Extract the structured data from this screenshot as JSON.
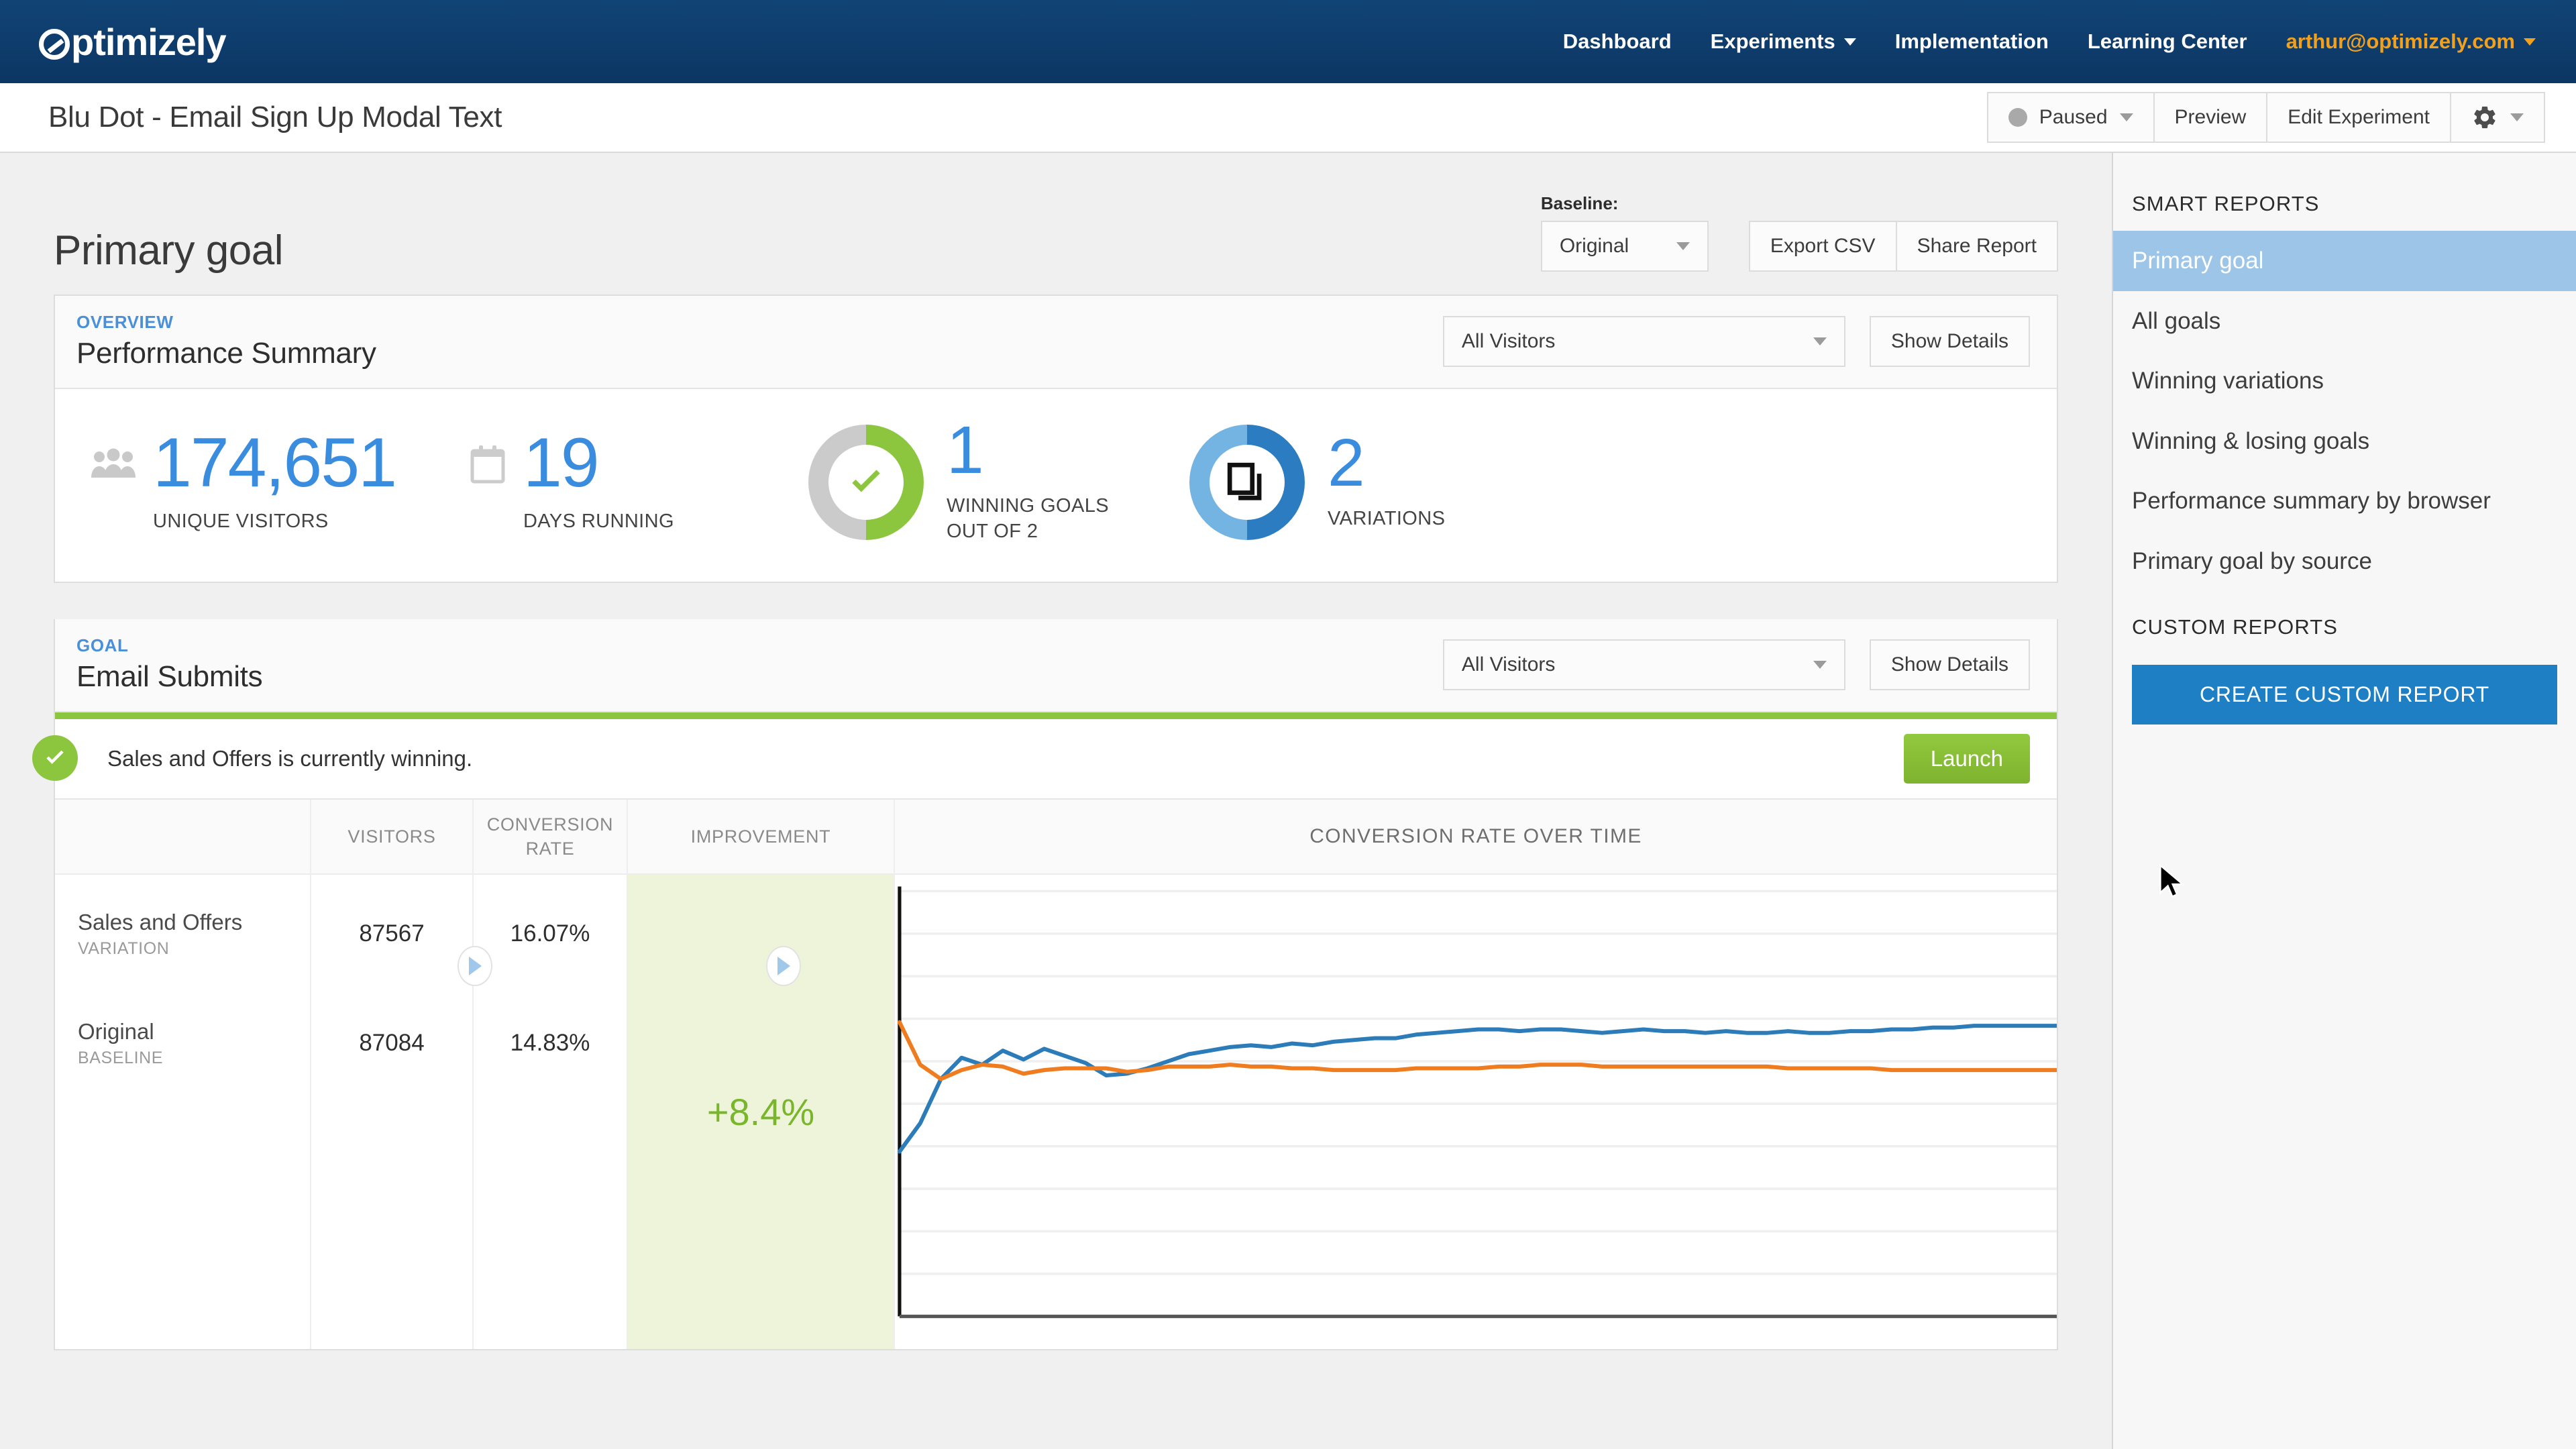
{
  "topnav": {
    "logo_text": "ptimizely",
    "items": [
      {
        "label": "Dashboard",
        "has_caret": false
      },
      {
        "label": "Experiments",
        "has_caret": true
      },
      {
        "label": "Implementation",
        "has_caret": false
      },
      {
        "label": "Learning Center",
        "has_caret": false
      }
    ],
    "user": "arthur@optimizely.com",
    "brand_color": "#0d3c6e",
    "user_color": "#f2a11e"
  },
  "subheader": {
    "experiment_title": "Blu Dot - Email Sign Up Modal Text",
    "status_label": "Paused",
    "preview_label": "Preview",
    "edit_label": "Edit Experiment"
  },
  "main": {
    "page_title": "Primary goal",
    "baseline_label": "Baseline:",
    "baseline_value": "Original",
    "export_csv_label": "Export CSV",
    "share_report_label": "Share Report"
  },
  "summary": {
    "kicker": "OVERVIEW",
    "title": "Performance Summary",
    "audience_value": "All Visitors",
    "show_details_label": "Show Details",
    "unique_visitors": "174,651",
    "unique_visitors_label": "UNIQUE VISITORS",
    "days_running": "19",
    "days_running_label": "DAYS RUNNING",
    "winning_goals": "1",
    "winning_goals_label_1": "WINNING GOALS",
    "winning_goals_label_2": "OUT OF 2",
    "variations": "2",
    "variations_label": "VARIATIONS"
  },
  "goal": {
    "kicker": "GOAL",
    "title": "Email Submits",
    "audience_value": "All Visitors",
    "show_details_label": "Show Details",
    "winning_message": "Sales and Offers is currently winning.",
    "launch_label": "Launch",
    "accent_color": "#8cc63e",
    "columns": {
      "name": "",
      "visitors": "VISITORS",
      "conversion_rate_line1": "CONVERSION",
      "conversion_rate_line2": "RATE",
      "improvement": "IMPROVEMENT",
      "chart": "CONVERSION RATE OVER TIME"
    },
    "rows": [
      {
        "name": "Sales and Offers",
        "type": "VARIATION",
        "visitors": "87567",
        "conversion_rate": "16.07%"
      },
      {
        "name": "Original",
        "type": "BASELINE",
        "visitors": "87084",
        "conversion_rate": "14.83%"
      }
    ],
    "improvement": "+8.4%"
  },
  "chart_data": {
    "type": "line",
    "title": "CONVERSION RATE OVER TIME",
    "xlabel": "",
    "ylabel": "",
    "grid": true,
    "legend": "none",
    "ylim": [
      0,
      24
    ],
    "series": [
      {
        "name": "Sales and Offers",
        "color": "#2b7cb8",
        "values": [
          9.3,
          10.9,
          13.4,
          14.6,
          14.2,
          15.0,
          14.5,
          15.1,
          14.7,
          14.3,
          13.6,
          13.7,
          14.0,
          14.4,
          14.8,
          15.0,
          15.2,
          15.3,
          15.2,
          15.4,
          15.3,
          15.5,
          15.6,
          15.7,
          15.7,
          15.9,
          16.0,
          16.1,
          16.2,
          16.2,
          16.1,
          16.2,
          16.2,
          16.1,
          16.0,
          16.1,
          16.2,
          16.1,
          16.1,
          16.0,
          16.1,
          16.0,
          16.0,
          16.1,
          16.0,
          16.0,
          16.1,
          16.1,
          16.2,
          16.2,
          16.3,
          16.3,
          16.4,
          16.4,
          16.4,
          16.4,
          16.4
        ]
      },
      {
        "name": "Original",
        "color": "#f07c20",
        "values": [
          16.6,
          14.2,
          13.4,
          13.9,
          14.2,
          14.1,
          13.7,
          13.9,
          14.0,
          14.0,
          14.0,
          13.8,
          13.9,
          14.1,
          14.1,
          14.1,
          14.2,
          14.1,
          14.1,
          14.0,
          14.0,
          13.9,
          13.9,
          13.9,
          13.9,
          14.0,
          14.0,
          14.0,
          14.0,
          14.1,
          14.1,
          14.2,
          14.2,
          14.2,
          14.1,
          14.1,
          14.1,
          14.1,
          14.1,
          14.1,
          14.1,
          14.1,
          14.1,
          14.0,
          14.0,
          14.0,
          14.0,
          14.0,
          13.9,
          13.9,
          13.9,
          13.9,
          13.9,
          13.9,
          13.9,
          13.9,
          13.9
        ]
      }
    ]
  },
  "sidebar": {
    "smart_reports_title": "SMART REPORTS",
    "items": [
      {
        "label": "Primary goal",
        "active": true
      },
      {
        "label": "All goals",
        "active": false
      },
      {
        "label": "Winning variations",
        "active": false
      },
      {
        "label": "Winning & losing goals",
        "active": false
      },
      {
        "label": "Performance summary by browser",
        "active": false
      },
      {
        "label": "Primary goal by source",
        "active": false
      }
    ],
    "custom_reports_title": "CUSTOM REPORTS",
    "create_button_label": "CREATE CUSTOM REPORT",
    "create_button_color": "#1f7fc4",
    "active_color": "#9cc5e8"
  }
}
